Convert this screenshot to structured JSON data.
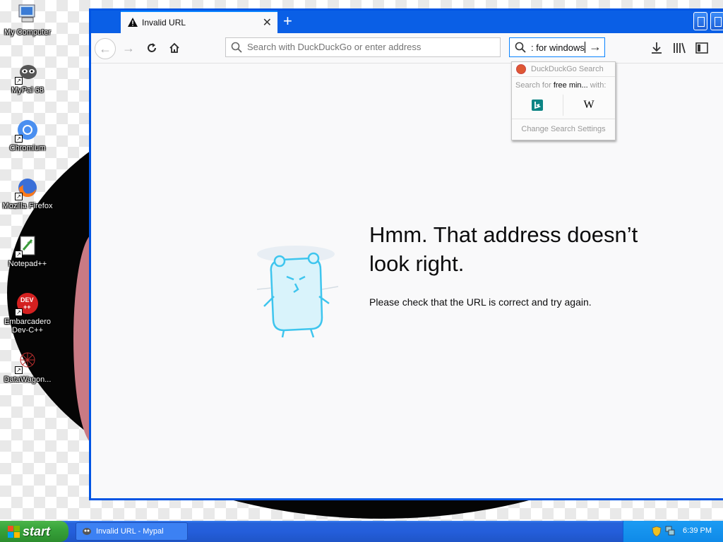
{
  "desktop": {
    "icons": [
      {
        "label": "My Computer",
        "icon": "computer-icon"
      },
      {
        "label": "MyPal 68",
        "icon": "mypal-icon"
      },
      {
        "label": "Chromium",
        "icon": "chromium-icon"
      },
      {
        "label": "Mozilla Firefox",
        "icon": "firefox-icon"
      },
      {
        "label": "Notepad++",
        "icon": "notepad-icon"
      },
      {
        "label": "Embarcadero Dev-C++",
        "icon": "devcpp-icon"
      },
      {
        "label": "DataWagon...",
        "icon": "datawagon-icon"
      }
    ]
  },
  "browser": {
    "tab_title": "Invalid URL",
    "url_placeholder": "Search with DuckDuckGo or enter address",
    "search_value": ": for windows",
    "search_popup": {
      "engine_header": "DuckDuckGo Search",
      "search_for_prefix": "Search for",
      "search_for_term": "free min...",
      "search_for_suffix": "with:",
      "engines": [
        "bing",
        "wikipedia"
      ],
      "wiki_glyph": "W",
      "settings_label": "Change Search Settings"
    },
    "error": {
      "title": "Hmm. That address doesn’t look right.",
      "description": "Please check that the URL is correct and try again."
    }
  },
  "taskbar": {
    "start_label": "start",
    "task_item": "Invalid URL - Mypal",
    "clock": "6:39 PM"
  },
  "colors": {
    "xp_blue": "#0054e3",
    "start_green": "#37a33a",
    "accent": "#0a84ff"
  }
}
